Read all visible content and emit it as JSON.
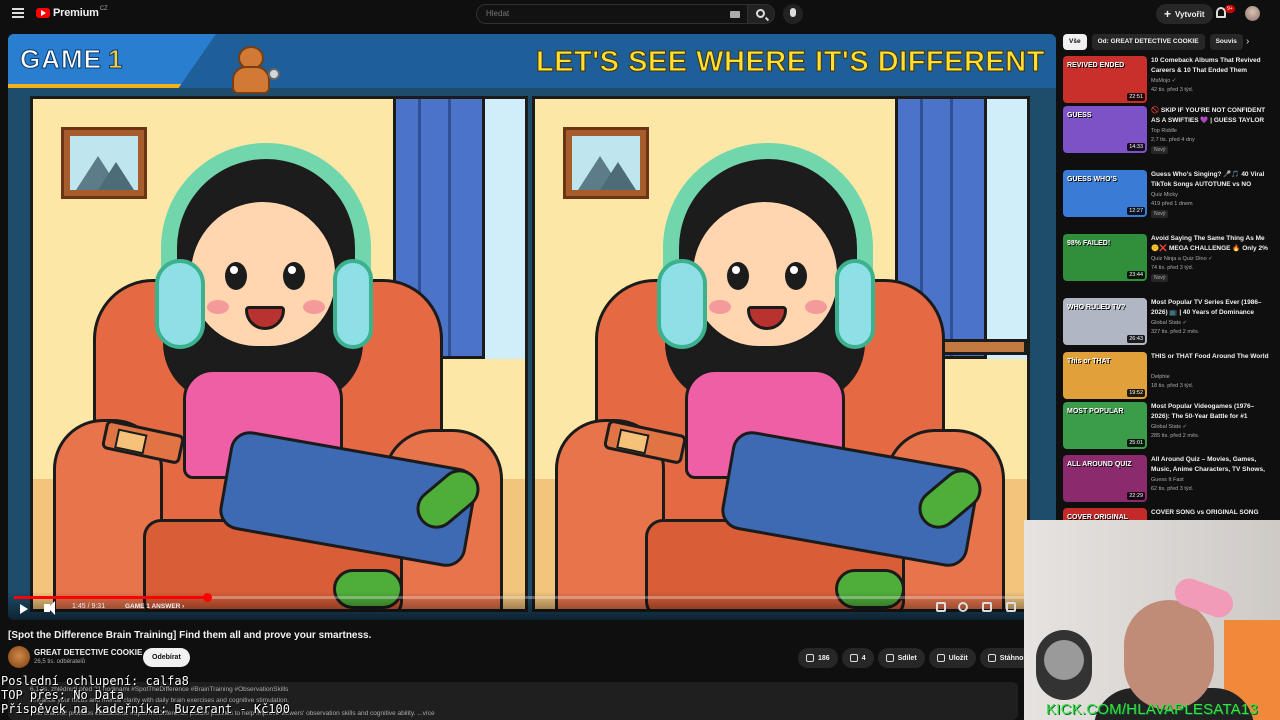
{
  "header": {
    "logo_text": "Premium",
    "logo_country": "CZ",
    "search_placeholder": "Hledat",
    "create_label": "Vytvořit",
    "notif_count": "9+"
  },
  "video": {
    "game_label": "GAME",
    "game_number": "1",
    "headline": "LET'S SEE WHERE IT'S DIFFERENT",
    "time": "1:45 / 9:31",
    "chapter": "GAME 1 ANSWER ›",
    "progress_fraction": 0.19
  },
  "info": {
    "title": "[Spot the Difference Brain Training] Find them all and prove your smartness.",
    "channel": "GREAT DETECTIVE COOKIE",
    "subscribers": "26,5 tis. odběratelů",
    "subscribe_label": "Odebírat",
    "likes": "186",
    "dislikes": "4",
    "share_label": "Sdílet",
    "save_label": "Uložit",
    "download_label": "Stáhnout",
    "desc_line1": "6,1 tis. zhlédnutí  před 21 hodinami  #SpotTheDifference #BrainTraining #ObservationSkills",
    "desc_line2": "Enhance your focus and mental clarity with daily brain exercises and cognitive stimulation.",
    "desc_line3": "This channel provides educational #SpotTheDifference picture puzzles to help improve viewers' observation skills and cognitive ability. ...více"
  },
  "overlay": {
    "line1": "Poslední ochlupení: calfa8",
    "line2": "TOP přes: No Data",
    "line3": "Příspěvek na kadeřníka: Buzerant - Kč100"
  },
  "sidebar": {
    "chips": [
      "Vše",
      "Od: GREAT DETECTIVE COOKIE",
      "Souvis"
    ],
    "items": [
      {
        "title": "10 Comeback Albums That Revived Careers & 10 That Ended Them",
        "channel": "MsMojo ✓",
        "meta": "42 tis.  před 3 týd.",
        "duration": "22:51",
        "thumb_text": "REVIVED  ENDED",
        "thumb_color": "#c9302c",
        "new": ""
      },
      {
        "title": "🚫 SKIP IF YOU'RE NOT CONFIDENT AS A SWIFTIES 💜 | GUESS TAYLOR SWIFT SONG BY ...",
        "channel": "Top Riddle",
        "meta": "2,7 tis.  před 4 dny",
        "duration": "14:33",
        "thumb_text": "GUESS",
        "thumb_color": "#7d52c7",
        "new": "Nový"
      },
      {
        "title": "Guess Who's Singing? 🎤🎵 40 Viral TikTok Songs AUTOTUNE vs NO AUTOTUNE | Dai Dai, Billie Jea...",
        "channel": "Quiz Micky",
        "meta": "419  před 1 dnem",
        "duration": "12:27",
        "thumb_text": "GUESS WHO'S",
        "thumb_color": "#3a7bd5",
        "new": "Nový"
      },
      {
        "title": "Avoid Saying The Same Thing As Me 🤫❌ MEGA CHALLENGE 🔥 Only 2% Reach the End!",
        "channel": "Quiz Ninja a Quiz Dino ✓",
        "meta": "74 tis.  před 3 týd.",
        "duration": "23:44",
        "thumb_text": "98% FAILED!",
        "thumb_color": "#2f8f3a",
        "new": "Nový"
      },
      {
        "title": "Most Popular TV Series Ever (1986–2026) 📺 | 40 Years of Dominance",
        "channel": "Global Stats ✓",
        "meta": "327 tis.  před 2 měs.",
        "duration": "26:43",
        "thumb_text": "WHO RULED TV?",
        "thumb_color": "#b0b6c4",
        "new": ""
      },
      {
        "title": "THIS or THAT Food Around The World",
        "channel": "Delphie",
        "meta": "18 tis.  před 3 týd.",
        "duration": "19:52",
        "thumb_text": "This or THAT",
        "thumb_color": "#e0a03a",
        "new": ""
      },
      {
        "title": "Most Popular Videogames (1976–2026): The 50-Year Battle for #1",
        "channel": "Global Stats ✓",
        "meta": "285 tis.  před 2 měs.",
        "duration": "25:01",
        "thumb_text": "MOST POPULAR",
        "thumb_color": "#3b9c4a",
        "new": ""
      },
      {
        "title": "All Around Quiz – Movies, Games, Music, Anime Characters, TV Shows, Pop Culture Trivia",
        "channel": "Guess It Fast",
        "meta": "62 tis.  před 3 týd.",
        "duration": "22:29",
        "thumb_text": "ALL AROUND QUIZ",
        "thumb_color": "#8c2a6e",
        "new": ""
      },
      {
        "title": "COVER SONG vs ORIGINAL SONG",
        "channel": "",
        "meta": "",
        "duration": "",
        "thumb_text": "COVER  ORIGINAL",
        "thumb_color": "#c42a2a",
        "new": ""
      }
    ]
  },
  "webcam": {
    "text": "KICK.COM/HLAVAPLESATA13"
  },
  "colors": {
    "background": "#0f0f0f",
    "accent_red": "#ff0000",
    "kick_green": "#3ee03e"
  }
}
